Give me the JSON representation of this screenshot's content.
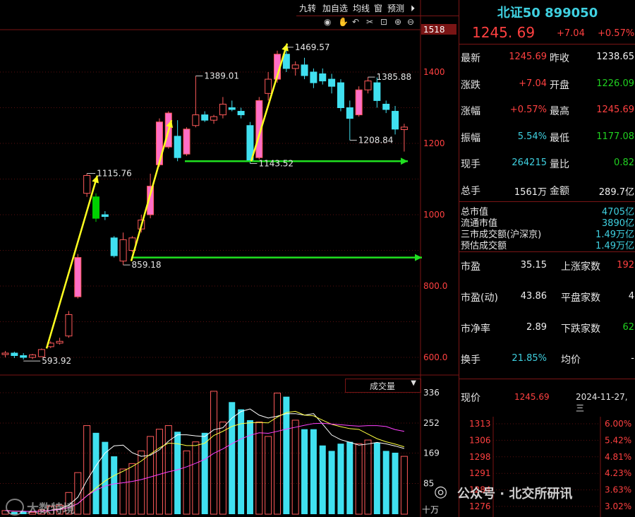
{
  "toolbar": {
    "jiuzhuan": "九转",
    "add_watch": "加自选",
    "ma_line": "均线",
    "window": "窗",
    "forecast": "预测",
    "icons": [
      "eye-icon",
      "hand-icon",
      "undo-icon",
      "scissors-icon",
      "lock-icon",
      "zoom-in-icon",
      "zoom-out-icon"
    ]
  },
  "chart_data": {
    "type": "candlestick",
    "price_axis": {
      "ticks": [
        "600.0",
        "800.0",
        "1000",
        "1200",
        "1400"
      ],
      "range": [
        595,
        1510
      ],
      "top_marker": "1518"
    },
    "candles": [
      {
        "o": 608,
        "h": 618,
        "l": 600,
        "c": 612
      },
      {
        "o": 612,
        "h": 616,
        "l": 598,
        "c": 605
      },
      {
        "o": 605,
        "h": 612,
        "l": 594,
        "c": 600
      },
      {
        "o": 600,
        "h": 610,
        "l": 595,
        "c": 607
      },
      {
        "o": 602,
        "h": 625,
        "l": 601,
        "c": 622
      },
      {
        "o": 630,
        "h": 645,
        "l": 626,
        "c": 640
      },
      {
        "o": 640,
        "h": 655,
        "l": 636,
        "c": 645
      },
      {
        "o": 660,
        "h": 730,
        "l": 655,
        "c": 720
      },
      {
        "o": 770,
        "h": 890,
        "l": 765,
        "c": 880
      },
      {
        "o": 1060,
        "h": 1115.76,
        "l": 1050,
        "c": 1110
      },
      {
        "o": 1050,
        "h": 1060,
        "l": 980,
        "c": 990
      },
      {
        "o": 1000,
        "h": 1010,
        "l": 985,
        "c": 995
      },
      {
        "o": 935,
        "h": 940,
        "l": 880,
        "c": 885
      },
      {
        "o": 870,
        "h": 950,
        "l": 859.18,
        "c": 930
      },
      {
        "o": 900,
        "h": 940,
        "l": 895,
        "c": 935
      },
      {
        "o": 960,
        "h": 1000,
        "l": 950,
        "c": 985
      },
      {
        "o": 1000,
        "h": 1115,
        "l": 990,
        "c": 1080
      },
      {
        "o": 1140,
        "h": 1270,
        "l": 1135,
        "c": 1260
      },
      {
        "o": 1190,
        "h": 1290,
        "l": 1185,
        "c": 1285
      },
      {
        "o": 1220,
        "h": 1265,
        "l": 1150,
        "c": 1160
      },
      {
        "o": 1170,
        "h": 1245,
        "l": 1165,
        "c": 1240
      },
      {
        "o": 1250,
        "h": 1389.01,
        "l": 1245,
        "c": 1280
      },
      {
        "o": 1280,
        "h": 1290,
        "l": 1260,
        "c": 1265
      },
      {
        "o": 1265,
        "h": 1280,
        "l": 1255,
        "c": 1275
      },
      {
        "o": 1280,
        "h": 1330,
        "l": 1270,
        "c": 1310
      },
      {
        "o": 1300,
        "h": 1320,
        "l": 1290,
        "c": 1295
      },
      {
        "o": 1290,
        "h": 1300,
        "l": 1270,
        "c": 1280
      },
      {
        "o": 1250,
        "h": 1260,
        "l": 1143.52,
        "c": 1150
      },
      {
        "o": 1160,
        "h": 1330,
        "l": 1155,
        "c": 1320
      },
      {
        "o": 1340,
        "h": 1400,
        "l": 1320,
        "c": 1380
      },
      {
        "o": 1380,
        "h": 1460,
        "l": 1370,
        "c": 1450
      },
      {
        "o": 1450,
        "h": 1469.57,
        "l": 1400,
        "c": 1410
      },
      {
        "o": 1410,
        "h": 1430,
        "l": 1390,
        "c": 1420
      },
      {
        "o": 1420,
        "h": 1440,
        "l": 1380,
        "c": 1390
      },
      {
        "o": 1400,
        "h": 1410,
        "l": 1355,
        "c": 1370
      },
      {
        "o": 1395,
        "h": 1410,
        "l": 1365,
        "c": 1375
      },
      {
        "o": 1380,
        "h": 1395,
        "l": 1340,
        "c": 1360
      },
      {
        "o": 1370,
        "h": 1380,
        "l": 1290,
        "c": 1300
      },
      {
        "o": 1300,
        "h": 1320,
        "l": 1208.84,
        "c": 1270
      },
      {
        "o": 1280,
        "h": 1360,
        "l": 1275,
        "c": 1350
      },
      {
        "o": 1350,
        "h": 1385.88,
        "l": 1340,
        "c": 1375
      },
      {
        "o": 1370,
        "h": 1385,
        "l": 1300,
        "c": 1320
      },
      {
        "o": 1310,
        "h": 1320,
        "l": 1285,
        "c": 1295
      },
      {
        "o": 1290,
        "h": 1305,
        "l": 1225,
        "c": 1240
      },
      {
        "o": 1238.65,
        "h": 1255,
        "l": 1177.08,
        "c": 1245.69
      }
    ],
    "price_labels": [
      "593.92",
      "1115.76",
      "859.18",
      "1389.01",
      "1143.52",
      "1469.57",
      "1208.84",
      "1385.88"
    ],
    "support_lines": [
      1150,
      880
    ],
    "volume": {
      "label": "成交量",
      "axis_ticks": [
        "336",
        "252",
        "169",
        "85"
      ],
      "unit": "十万",
      "range": [
        0,
        340
      ],
      "values": [
        10,
        6,
        8,
        5,
        12,
        22,
        25,
        60,
        115,
        245,
        225,
        200,
        160,
        125,
        140,
        175,
        215,
        235,
        245,
        228,
        175,
        200,
        225,
        340,
        255,
        310,
        290,
        260,
        255,
        215,
        335,
        325,
        260,
        235,
        235,
        190,
        175,
        195,
        200,
        195,
        205,
        198,
        175,
        170,
        160
      ]
    }
  },
  "quote": {
    "title": "北证50 899050",
    "price": "1245. 69",
    "change": "+7.04",
    "change_pct": "+0.57%",
    "rows": [
      {
        "l1": "最新",
        "v1": "1245.69",
        "c1": "red",
        "l2": "昨收",
        "v2": "1238.65",
        "c2": "white"
      },
      {
        "l1": "涨跌",
        "v1": "+7.04",
        "c1": "red",
        "l2": "开盘",
        "v2": "1226.09",
        "c2": "green"
      },
      {
        "l1": "涨幅",
        "v1": "+0.57%",
        "c1": "red",
        "l2": "最高",
        "v2": "1245.69",
        "c2": "red"
      },
      {
        "l1": "振幅",
        "v1": "5.54%",
        "c1": "cyan",
        "l2": "最低",
        "v2": "1177.08",
        "c2": "green"
      },
      {
        "l1": "现手",
        "v1": "264215",
        "c1": "cyan",
        "l2": "量比",
        "v2": "0.82",
        "c2": "green"
      },
      {
        "l1": "总手",
        "v1": "1561万",
        "c1": "white",
        "l2": "金额",
        "v2": "289.7亿",
        "c2": "white"
      }
    ],
    "market": [
      {
        "label": "总市值",
        "value": "4705亿"
      },
      {
        "label": "流通市值",
        "value": "3890亿"
      },
      {
        "label": "三市成交额(沪深京)",
        "value": "1.49万亿"
      },
      {
        "label": "预估成交额",
        "value": "1.49万亿"
      }
    ],
    "stats": [
      {
        "l1": "市盈",
        "v1": "35.15",
        "l2": "上涨家数",
        "v2": "192",
        "c2": "red"
      },
      {
        "l1": "市盈(动)",
        "v1": "43.86",
        "l2": "平盘家数",
        "v2": "4",
        "c2": "white"
      },
      {
        "l1": "市净率",
        "v1": "2.89",
        "l2": "下跌家数",
        "v2": "62",
        "c2": "green"
      },
      {
        "l1": "换手",
        "v1": "21.85%",
        "l2": "均价",
        "v2": "-",
        "c2": "white"
      }
    ],
    "now_label": "现价",
    "now_price": "1245.69",
    "now_date": "2024-11-27,三",
    "mini_prices": [
      "1313",
      "1306",
      "1298",
      "1291",
      "1284",
      "1276"
    ],
    "mini_pcts": [
      "6.00%",
      "5.42%",
      "4.81%",
      "4.23%",
      "3.63%",
      "3.02%"
    ]
  },
  "watermark": {
    "left": "大数特境",
    "right": "公众号 · 北交所研讯"
  },
  "colors": {
    "up": "#ff5a5a",
    "up_fill": "#ff6ec7",
    "down": "#40e0f0",
    "dark_down": "#00d000",
    "arrow": "#ffff20",
    "support": "#20e020",
    "grid": "#5a0f0f"
  }
}
